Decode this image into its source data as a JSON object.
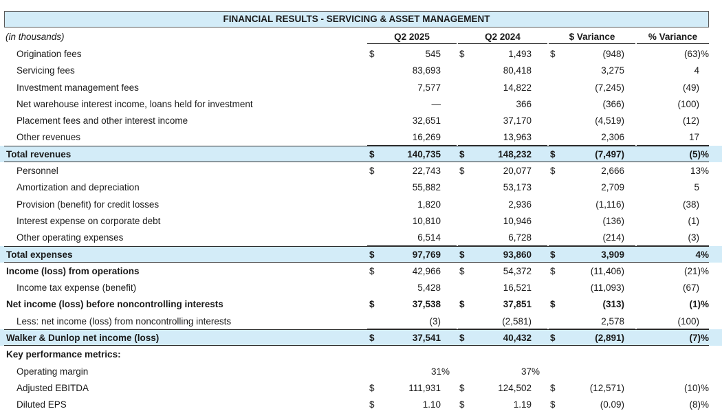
{
  "title": "FINANCIAL RESULTS - SERVICING & ASSET MANAGEMENT",
  "header": {
    "units": "(in thousands)",
    "col1": "Q2 2025",
    "col2": "Q2 2024",
    "col3": "$ Variance",
    "col4": "% Variance"
  },
  "rows": [
    {
      "label": "Origination fees",
      "d1": "$",
      "q25": "545",
      "d2": "$",
      "q24": "1,493",
      "d3": "$",
      "var": "(948)",
      "pct": "(63)%",
      "style": "normal"
    },
    {
      "label": "Servicing fees",
      "d1": "",
      "q25": "83,693",
      "d2": "",
      "q24": "80,418",
      "d3": "",
      "var": "3,275",
      "pct": "4",
      "style": "normal"
    },
    {
      "label": "Investment management fees",
      "d1": "",
      "q25": "7,577",
      "d2": "",
      "q24": "14,822",
      "d3": "",
      "var": "(7,245)",
      "pct": "(49)",
      "style": "normal"
    },
    {
      "label": "Net warehouse interest income, loans held for investment",
      "d1": "",
      "q25": "—",
      "d2": "",
      "q24": "366",
      "d3": "",
      "var": "(366)",
      "pct": "(100)",
      "style": "normal"
    },
    {
      "label": "Placement fees and other interest income",
      "d1": "",
      "q25": "32,651",
      "d2": "",
      "q24": "37,170",
      "d3": "",
      "var": "(4,519)",
      "pct": "(12)",
      "style": "normal"
    },
    {
      "label": "Other revenues",
      "d1": "",
      "q25": "16,269",
      "d2": "",
      "q24": "13,963",
      "d3": "",
      "var": "2,306",
      "pct": "17",
      "style": "normal"
    },
    {
      "label": "Total revenues",
      "d1": "$",
      "q25": "140,735",
      "d2": "$",
      "q24": "148,232",
      "d3": "$",
      "var": "(7,497)",
      "pct": "(5)%",
      "style": "total"
    },
    {
      "label": "Personnel",
      "d1": "$",
      "q25": "22,743",
      "d2": "$",
      "q24": "20,077",
      "d3": "$",
      "var": "2,666",
      "pct": "13%",
      "style": "normal"
    },
    {
      "label": "Amortization and depreciation",
      "d1": "",
      "q25": "55,882",
      "d2": "",
      "q24": "53,173",
      "d3": "",
      "var": "2,709",
      "pct": "5",
      "style": "normal"
    },
    {
      "label": "Provision (benefit) for credit losses",
      "d1": "",
      "q25": "1,820",
      "d2": "",
      "q24": "2,936",
      "d3": "",
      "var": "(1,116)",
      "pct": "(38)",
      "style": "normal"
    },
    {
      "label": "Interest expense on corporate debt",
      "d1": "",
      "q25": "10,810",
      "d2": "",
      "q24": "10,946",
      "d3": "",
      "var": "(136)",
      "pct": "(1)",
      "style": "normal"
    },
    {
      "label": "Other operating expenses",
      "d1": "",
      "q25": "6,514",
      "d2": "",
      "q24": "6,728",
      "d3": "",
      "var": "(214)",
      "pct": "(3)",
      "style": "normal"
    },
    {
      "label": "Total expenses",
      "d1": "$",
      "q25": "97,769",
      "d2": "$",
      "q24": "93,860",
      "d3": "$",
      "var": "3,909",
      "pct": "4%",
      "style": "total"
    },
    {
      "label": "Income (loss) from operations",
      "d1": "$",
      "q25": "42,966",
      "d2": "$",
      "q24": "54,372",
      "d3": "$",
      "var": "(11,406)",
      "pct": "(21)%",
      "style": "boldlabel"
    },
    {
      "label": "Income tax expense (benefit)",
      "d1": "",
      "q25": "5,428",
      "d2": "",
      "q24": "16,521",
      "d3": "",
      "var": "(11,093)",
      "pct": "(67)",
      "style": "normal"
    },
    {
      "label": "Net income (loss) before noncontrolling interests",
      "d1": "$",
      "q25": "37,538",
      "d2": "$",
      "q24": "37,851",
      "d3": "$",
      "var": "(313)",
      "pct": "(1)%",
      "style": "bold"
    },
    {
      "label": "Less: net income (loss) from noncontrolling interests",
      "d1": "",
      "q25": "(3)",
      "d2": "",
      "q24": "(2,581)",
      "d3": "",
      "var": "2,578",
      "pct": "(100)",
      "style": "normal"
    },
    {
      "label": "Walker & Dunlop net income (loss)",
      "d1": "$",
      "q25": "37,541",
      "d2": "$",
      "q24": "40,432",
      "d3": "$",
      "var": "(2,891)",
      "pct": "(7)%",
      "style": "total"
    },
    {
      "label": "Key performance metrics:",
      "d1": "",
      "q25": "",
      "d2": "",
      "q24": "",
      "d3": "",
      "var": "",
      "pct": "",
      "style": "section"
    },
    {
      "label": "Operating margin",
      "d1": "",
      "q25": "31%",
      "d2": "",
      "q24": "37%",
      "d3": "",
      "var": "",
      "pct": "",
      "style": "metric"
    },
    {
      "label": "Adjusted EBITDA",
      "d1": "$",
      "q25": "111,931",
      "d2": "$",
      "q24": "124,502",
      "d3": "$",
      "var": "(12,571)",
      "pct": "(10)%",
      "style": "normal"
    },
    {
      "label": "Diluted EPS",
      "d1": "$",
      "q25": "1.10",
      "d2": "$",
      "q24": "1.19",
      "d3": "$",
      "var": "(0.09)",
      "pct": "(8)%",
      "style": "normal"
    }
  ]
}
